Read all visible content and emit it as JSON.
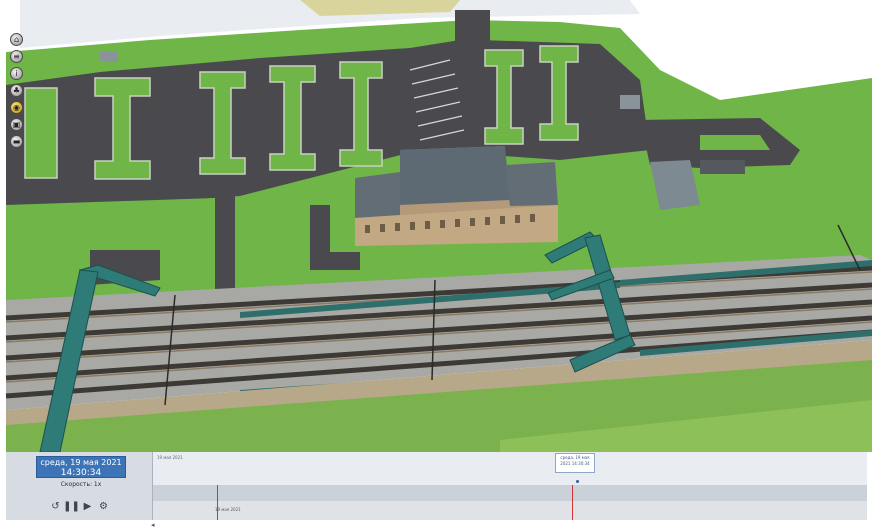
{
  "toolbar": {
    "buttons": [
      {
        "name": "home-icon",
        "glyph": "⌂"
      },
      {
        "name": "layers-icon",
        "glyph": "≡"
      },
      {
        "name": "info-icon",
        "glyph": "i"
      },
      {
        "name": "tree-icon",
        "glyph": "♣"
      },
      {
        "name": "view-icon",
        "glyph": "◉"
      },
      {
        "name": "camera-icon",
        "glyph": "▣"
      },
      {
        "name": "ruler-icon",
        "glyph": "▬"
      }
    ]
  },
  "timeline": {
    "date_line1": "среда, 19 мая 2021",
    "date_line2": "14:30:34",
    "speed_label": "Скорость: 1x",
    "start_label": "19 мая 2021",
    "marker_label": "среда, 19 мая 2021 14:30:34",
    "tick_date_label": "19 мая 2021",
    "controls": {
      "rewind_glyph": "↺",
      "pause_glyph": "❚❚",
      "play_glyph": "▶",
      "settings_glyph": "⚙"
    }
  },
  "colors": {
    "grass": "#6fb547",
    "asphalt": "#4a4a4e",
    "pedestrian_bridge": "#2f7b77",
    "roof": "#5e6a73",
    "building_wall": "#b49a78",
    "timeline_accent": "#3d74b8",
    "timeline_marker": "#d03434"
  }
}
